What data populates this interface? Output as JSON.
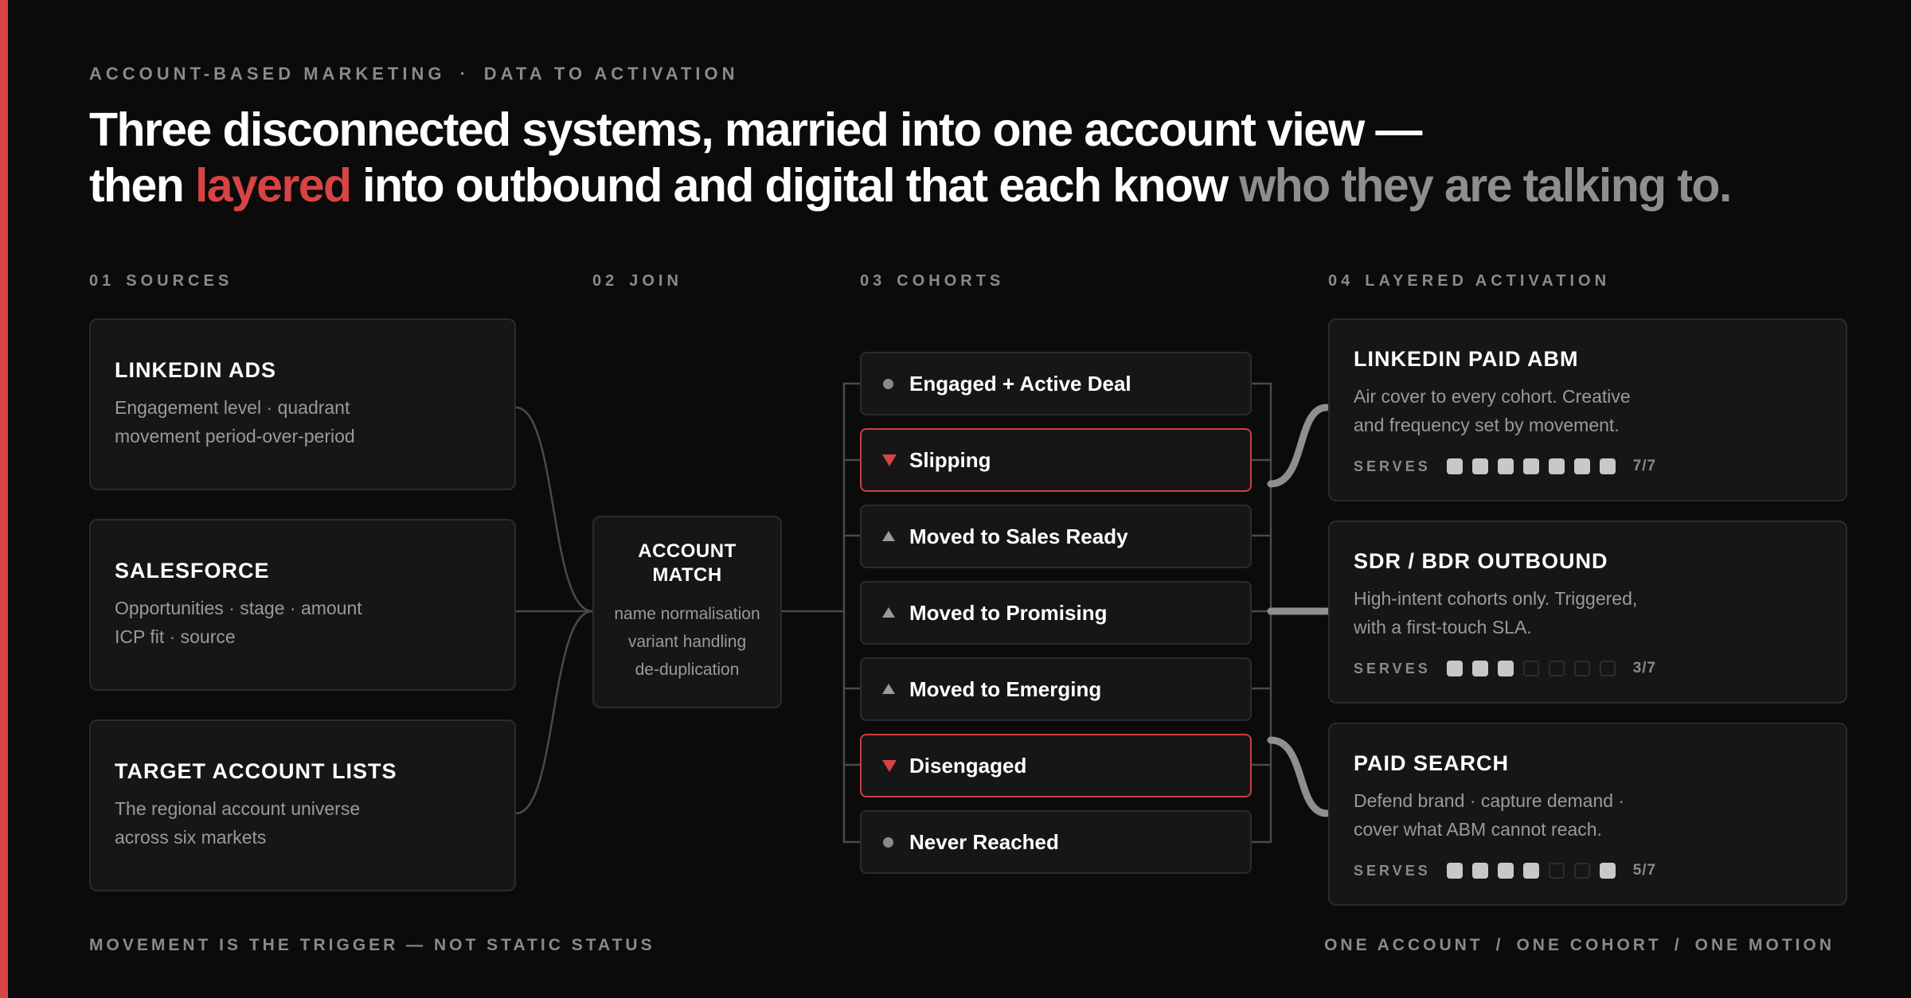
{
  "eyebrow": {
    "left": "ACCOUNT-BASED MARKETING",
    "separator": "·",
    "right": "DATA TO ACTIVATION"
  },
  "headline": {
    "line1": "Three disconnected systems, married into one account view —",
    "line2_pre": "then ",
    "line2_red": "layered",
    "line2_mid": " into outbound and digital that each know ",
    "line2_dim": "who they are talking to."
  },
  "columns": [
    {
      "num": "01",
      "label": "SOURCES"
    },
    {
      "num": "02",
      "label": "JOIN"
    },
    {
      "num": "03",
      "label": "COHORTS"
    },
    {
      "num": "04",
      "label": "LAYERED ACTIVATION"
    }
  ],
  "sources": [
    {
      "title": "LINKEDIN ADS",
      "lines": [
        "Engagement level · quadrant",
        "movement period-over-period"
      ]
    },
    {
      "title": "SALESFORCE",
      "lines": [
        "Opportunities · stage · amount",
        "ICP fit · source"
      ]
    },
    {
      "title": "TARGET ACCOUNT LISTS",
      "lines": [
        "The regional account universe",
        "across six markets"
      ]
    }
  ],
  "join": {
    "title_lines": [
      "ACCOUNT",
      "MATCH"
    ],
    "desc_lines": [
      "name normalisation",
      "variant handling",
      "de-duplication"
    ]
  },
  "cohorts": [
    {
      "label": "Engaged + Active Deal",
      "marker": "dot",
      "alert": false
    },
    {
      "label": "Slipping",
      "marker": "down",
      "alert": true
    },
    {
      "label": "Moved to Sales Ready",
      "marker": "up",
      "alert": false
    },
    {
      "label": "Moved to Promising",
      "marker": "up",
      "alert": false
    },
    {
      "label": "Moved to Emerging",
      "marker": "up",
      "alert": false
    },
    {
      "label": "Disengaged",
      "marker": "down",
      "alert": true
    },
    {
      "label": "Never Reached",
      "marker": "dot",
      "alert": false
    }
  ],
  "activations": [
    {
      "title": "LINKEDIN PAID ABM",
      "lines": [
        "Air cover to every cohort. Creative",
        "and frequency set by movement."
      ],
      "serves_label": "SERVES",
      "served": 7,
      "total": 7,
      "count": "7/7",
      "pips": [
        1,
        1,
        1,
        1,
        1,
        1,
        1
      ]
    },
    {
      "title": "SDR / BDR OUTBOUND",
      "lines": [
        "High-intent cohorts only. Triggered,",
        "with a first-touch SLA."
      ],
      "serves_label": "SERVES",
      "served": 3,
      "total": 7,
      "count": "3/7",
      "pips": [
        1,
        1,
        1,
        0,
        0,
        0,
        0
      ]
    },
    {
      "title": "PAID SEARCH",
      "lines": [
        "Defend brand · capture demand ·",
        "cover what ABM cannot reach."
      ],
      "serves_label": "SERVES",
      "served": 5,
      "total": 7,
      "count": "5/7",
      "pips": [
        1,
        1,
        1,
        1,
        0,
        0,
        1
      ]
    }
  ],
  "footer": {
    "left": "MOVEMENT IS THE TRIGGER — NOT STATIC STATUS",
    "right": [
      "ONE ACCOUNT",
      "ONE COHORT",
      "ONE MOTION"
    ],
    "right_separator": "/"
  },
  "colors": {
    "accent": "#d84343",
    "background": "#0b0b0b",
    "card": "#161616",
    "muted": "#8a8a8a"
  }
}
